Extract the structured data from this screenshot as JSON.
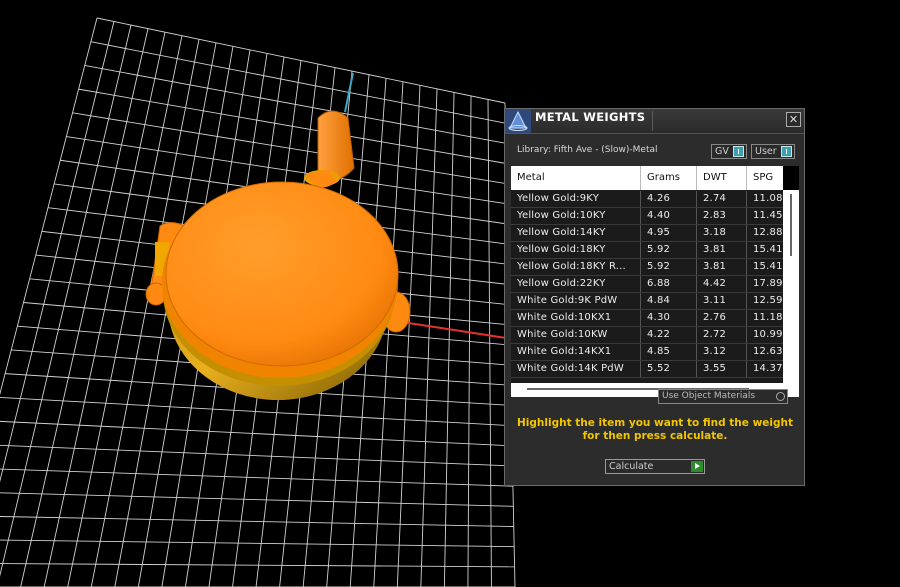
{
  "window": {
    "title": "METAL WEIGHTS",
    "close_glyph": "✕"
  },
  "library_label": "Library: Fifth Ave - (Slow)-Metal",
  "toggles": {
    "gv": "GV",
    "user": "User"
  },
  "table": {
    "columns": [
      "Metal",
      "Grams",
      "DWT",
      "SPG"
    ],
    "rows": [
      [
        "Yellow Gold:9KY",
        "4.26",
        "2.74",
        "11.08"
      ],
      [
        "Yellow Gold:10KY",
        "4.40",
        "2.83",
        "11.45"
      ],
      [
        "Yellow Gold:14KY",
        "4.95",
        "3.18",
        "12.88"
      ],
      [
        "Yellow Gold:18KY",
        "5.92",
        "3.81",
        "15.41"
      ],
      [
        "Yellow Gold:18KY R...",
        "5.92",
        "3.81",
        "15.41"
      ],
      [
        "Yellow Gold:22KY",
        "6.88",
        "4.42",
        "17.89"
      ],
      [
        "White Gold:9K PdW",
        "4.84",
        "3.11",
        "12.59"
      ],
      [
        "White Gold:10KX1",
        "4.30",
        "2.76",
        "11.18"
      ],
      [
        "White Gold:10KW",
        "4.22",
        "2.72",
        "10.99"
      ],
      [
        "White Gold:14KX1",
        "4.85",
        "3.12",
        "12.63"
      ],
      [
        "White Gold:14K PdW",
        "5.52",
        "3.55",
        "14.37"
      ]
    ]
  },
  "use_object_materials": "Use Object Materials",
  "instructions": "Highlight the item you want to find the weight for then press calculate.",
  "calculate_label": "Calculate",
  "icons": {
    "app": "pyramid-app-icon",
    "close": "close-icon",
    "calculate": "play-arrow-icon"
  },
  "colors": {
    "model": "#ff8a1a",
    "instruction_text": "#f2c600",
    "grid_line": "#d8d8d8",
    "axis_x": "#e53030",
    "axis_y": "#3aa9c2"
  }
}
